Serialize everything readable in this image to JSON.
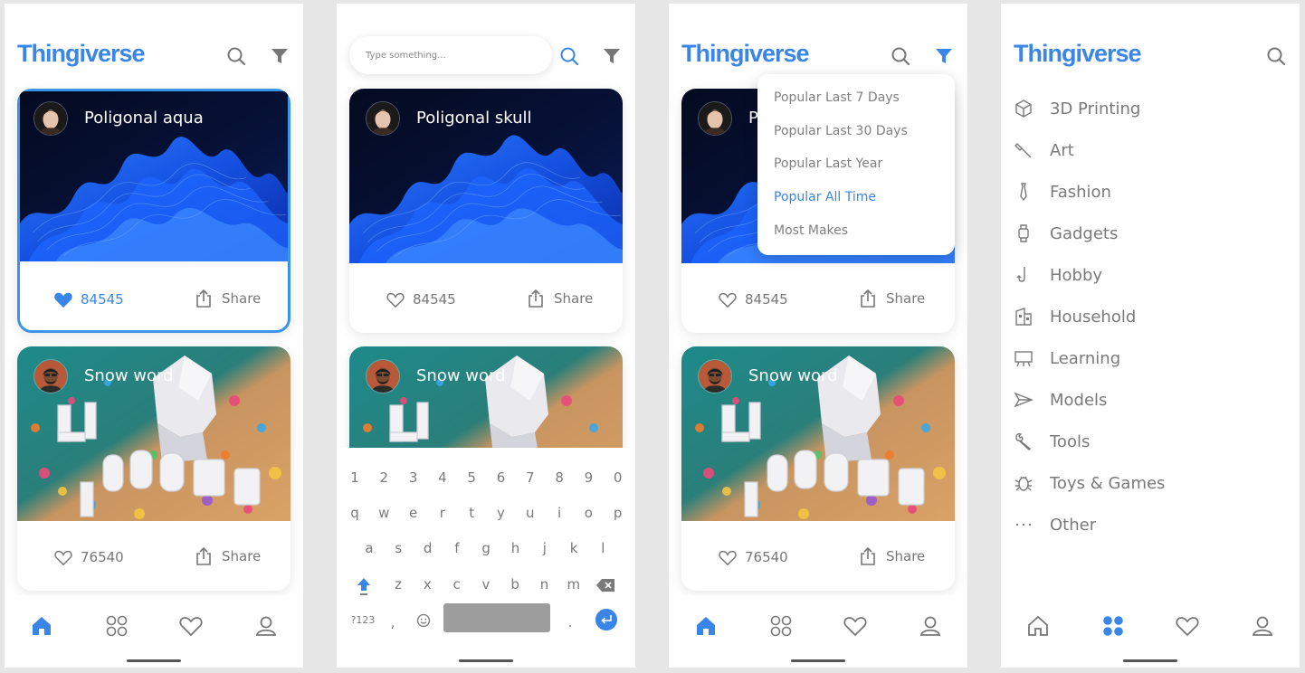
{
  "app": {
    "name": "Thingiverse"
  },
  "colors": {
    "accent": "#3a86e8",
    "text": "#7a7a7a",
    "background": "#e6e6e6"
  },
  "feed": {
    "cards": [
      {
        "title": "Poligonal aqua",
        "likes": "84545",
        "share": "Share",
        "image": "blue-waves",
        "liked": true
      },
      {
        "title": "Snow word",
        "likes": "76540",
        "share": "Share",
        "image": "let-it-snow",
        "liked": false
      }
    ]
  },
  "search_screen": {
    "placeholder": "Type something...",
    "cards": [
      {
        "title": "Poligonal skull",
        "likes": "84545",
        "share": "Share"
      },
      {
        "title": "Snow word"
      }
    ],
    "keyboard": {
      "row1": [
        "1",
        "2",
        "3",
        "4",
        "5",
        "6",
        "7",
        "8",
        "9",
        "0"
      ],
      "row2": [
        "q",
        "w",
        "e",
        "r",
        "t",
        "y",
        "u",
        "i",
        "o",
        "p"
      ],
      "row3": [
        "a",
        "s",
        "d",
        "f",
        "g",
        "h",
        "j",
        "k",
        "l"
      ],
      "row4": [
        "z",
        "x",
        "c",
        "v",
        "b",
        "n",
        "m"
      ],
      "mode_key": "?123",
      "comma": ",",
      "period": "."
    }
  },
  "filter_screen": {
    "options": [
      "Popular Last 7 Days",
      "Popular Last 30 Days",
      "Popular Last Year",
      "Popular All Time",
      "Most Makes"
    ],
    "selected": "Popular All Time",
    "cards": [
      {
        "title": "Poligonal aqua",
        "visible_title": "P",
        "likes": "84545",
        "share": "Share"
      },
      {
        "title": "Snow word",
        "likes": "76540",
        "share": "Share"
      }
    ]
  },
  "categories_screen": {
    "categories": [
      {
        "label": "3D Printing",
        "icon": "cube-icon"
      },
      {
        "label": "Art",
        "icon": "brush-icon"
      },
      {
        "label": "Fashion",
        "icon": "tie-icon"
      },
      {
        "label": "Gadgets",
        "icon": "watch-icon"
      },
      {
        "label": "Hobby",
        "icon": "hook-icon"
      },
      {
        "label": "Household",
        "icon": "building-icon"
      },
      {
        "label": "Learning",
        "icon": "board-icon"
      },
      {
        "label": "Models",
        "icon": "plane-icon"
      },
      {
        "label": "Tools",
        "icon": "wrench-icon"
      },
      {
        "label": "Toys & Games",
        "icon": "bug-icon"
      },
      {
        "label": "Other",
        "icon": "more-icon"
      }
    ]
  },
  "tabbar": {
    "tabs": [
      {
        "name": "home",
        "icon": "home-icon"
      },
      {
        "name": "categories",
        "icon": "grid-icon"
      },
      {
        "name": "favorites",
        "icon": "heart-icon"
      },
      {
        "name": "profile",
        "icon": "user-icon"
      }
    ]
  }
}
